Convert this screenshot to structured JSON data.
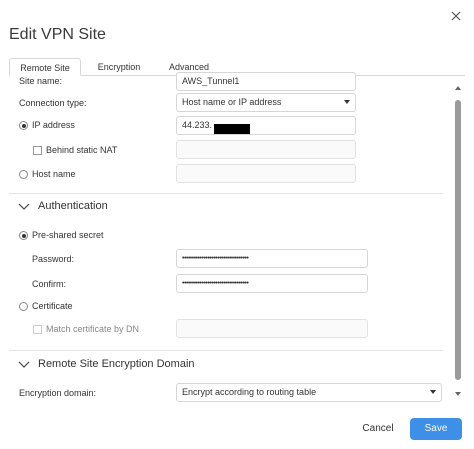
{
  "dialog": {
    "title": "Edit VPN Site"
  },
  "tabs": [
    {
      "label": "Remote Site",
      "active": true
    },
    {
      "label": "Encryption",
      "active": false
    },
    {
      "label": "Advanced",
      "active": false
    }
  ],
  "form": {
    "site_name_label": "Site name:",
    "site_name_value": "AWS_Tunnel1",
    "connection_type_label": "Connection type:",
    "connection_type_value": "Host name or IP address",
    "ip_address_label": "IP address",
    "ip_address_value": "44.233.",
    "behind_static_nat_label": "Behind static NAT",
    "host_name_label": "Host name"
  },
  "authentication": {
    "title": "Authentication",
    "preshared_label": "Pre-shared secret",
    "password_label": "Password:",
    "password_value": "••••••••••••••••••••••••••••••••••",
    "confirm_label": "Confirm:",
    "confirm_value": "••••••••••••••••••••••••••••••••••",
    "certificate_label": "Certificate",
    "match_cert_label": "Match certificate by DN"
  },
  "encryption_domain": {
    "title": "Remote Site Encryption Domain",
    "label": "Encryption domain:",
    "value": "Encrypt according to routing table"
  },
  "footer": {
    "cancel_label": "Cancel",
    "save_label": "Save"
  },
  "colors": {
    "accent": "#3d8fe8",
    "text": "#333333",
    "border": "#d6d6d6"
  }
}
